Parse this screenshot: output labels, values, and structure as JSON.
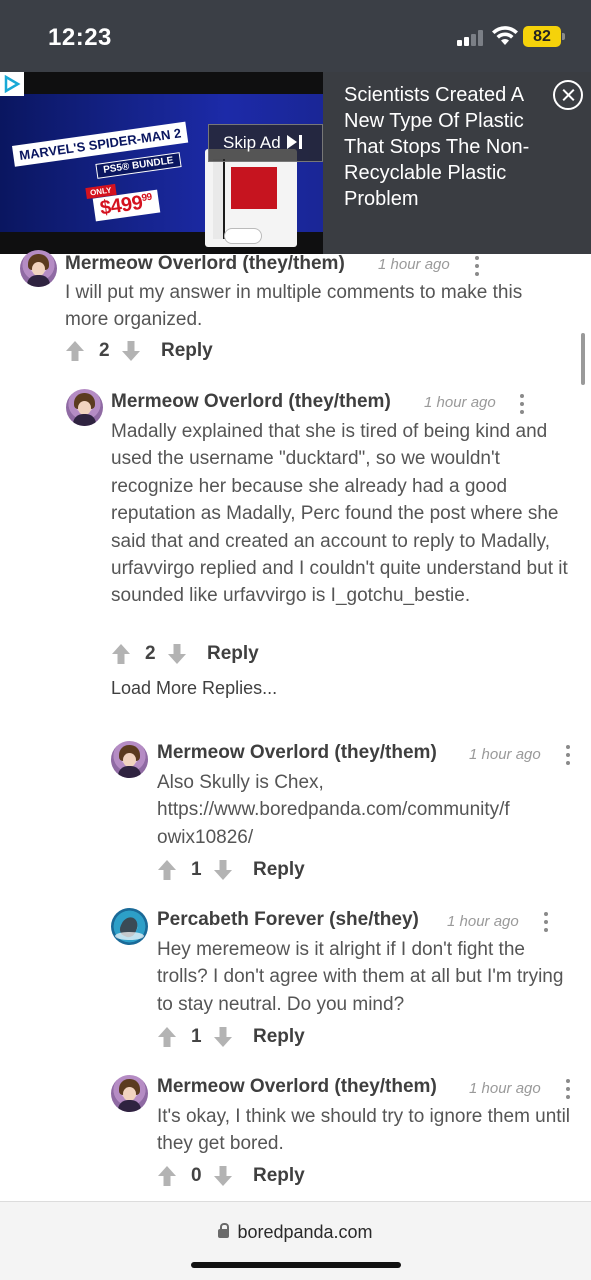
{
  "status_bar": {
    "time": "12:23",
    "battery": "82"
  },
  "ad": {
    "promo_title": "MARVEL'S SPIDER-MAN 2",
    "promo_sub": "PS5® BUNDLE",
    "promo_only": "ONLY",
    "promo_price": "$499",
    "promo_cents": "99",
    "skip_label": "Skip Ad",
    "headline": "Scientists Created A New Type Of Plastic That Stops The Non-Recyclable Plastic Problem"
  },
  "comments": [
    {
      "author": "Mermeow Overlord (they/them)",
      "time": "1 hour ago",
      "text": "I will put my answer in multiple comments to make this more organized.",
      "votes": "2",
      "reply_label": "Reply"
    },
    {
      "author": "Mermeow Overlord (they/them)",
      "time": "1 hour ago",
      "text": "Madally explained that she is tired of being kind and used the username \"ducktard\", so we wouldn't recognize her because she already had a good reputation as Madally, Perc found the post where she said that and created an account to reply to Madally, urfavvirgo replied and I couldn't quite understand but it sounded like urfavvirgo is I_gotchu_bestie.",
      "votes": "2",
      "reply_label": "Reply"
    },
    {
      "author": "Mermeow Overlord (they/them)",
      "time": "1 hour ago",
      "text_line1": "Also Skully is Chex,",
      "text_line2": "https://www.boredpanda.com/community/f",
      "text_line3": "owix10826/",
      "votes": "1",
      "reply_label": "Reply"
    },
    {
      "author": "Percabeth Forever (she/they)",
      "time": "1 hour ago",
      "text": "Hey meremeow is it alright if I don't fight the trolls? I don't agree with them at all but I'm trying to stay neutral. Do you mind?",
      "votes": "1",
      "reply_label": "Reply"
    },
    {
      "author": "Mermeow Overlord (they/them)",
      "time": "1 hour ago",
      "text": "It's okay, I think we should try to ignore them until they get bored.",
      "votes": "0",
      "reply_label": "Reply"
    }
  ],
  "load_more": "Load More Replies...",
  "browser": {
    "url": "boredpanda.com"
  }
}
